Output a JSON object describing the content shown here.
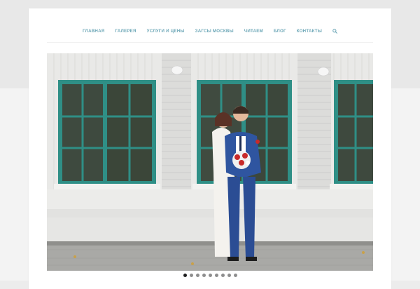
{
  "nav": {
    "items": [
      {
        "label": "ГЛАВНАЯ"
      },
      {
        "label": "ГАЛЕРЕЯ"
      },
      {
        "label": "УСЛУГИ И ЦЕНЫ"
      },
      {
        "label": "ЗАГСЫ МОСКВЫ"
      },
      {
        "label": "ЧИТАЕМ"
      },
      {
        "label": "БЛОГ"
      },
      {
        "label": "КОНТАКТЫ"
      }
    ],
    "search_icon": "search-icon"
  },
  "slider": {
    "slide_count": 9,
    "active_index": 0
  },
  "colors": {
    "nav_link": "#6ea8b8",
    "window_frame": "#2f8f86",
    "dot": "#8e8e8e",
    "dot_active": "#1e1e1e"
  }
}
